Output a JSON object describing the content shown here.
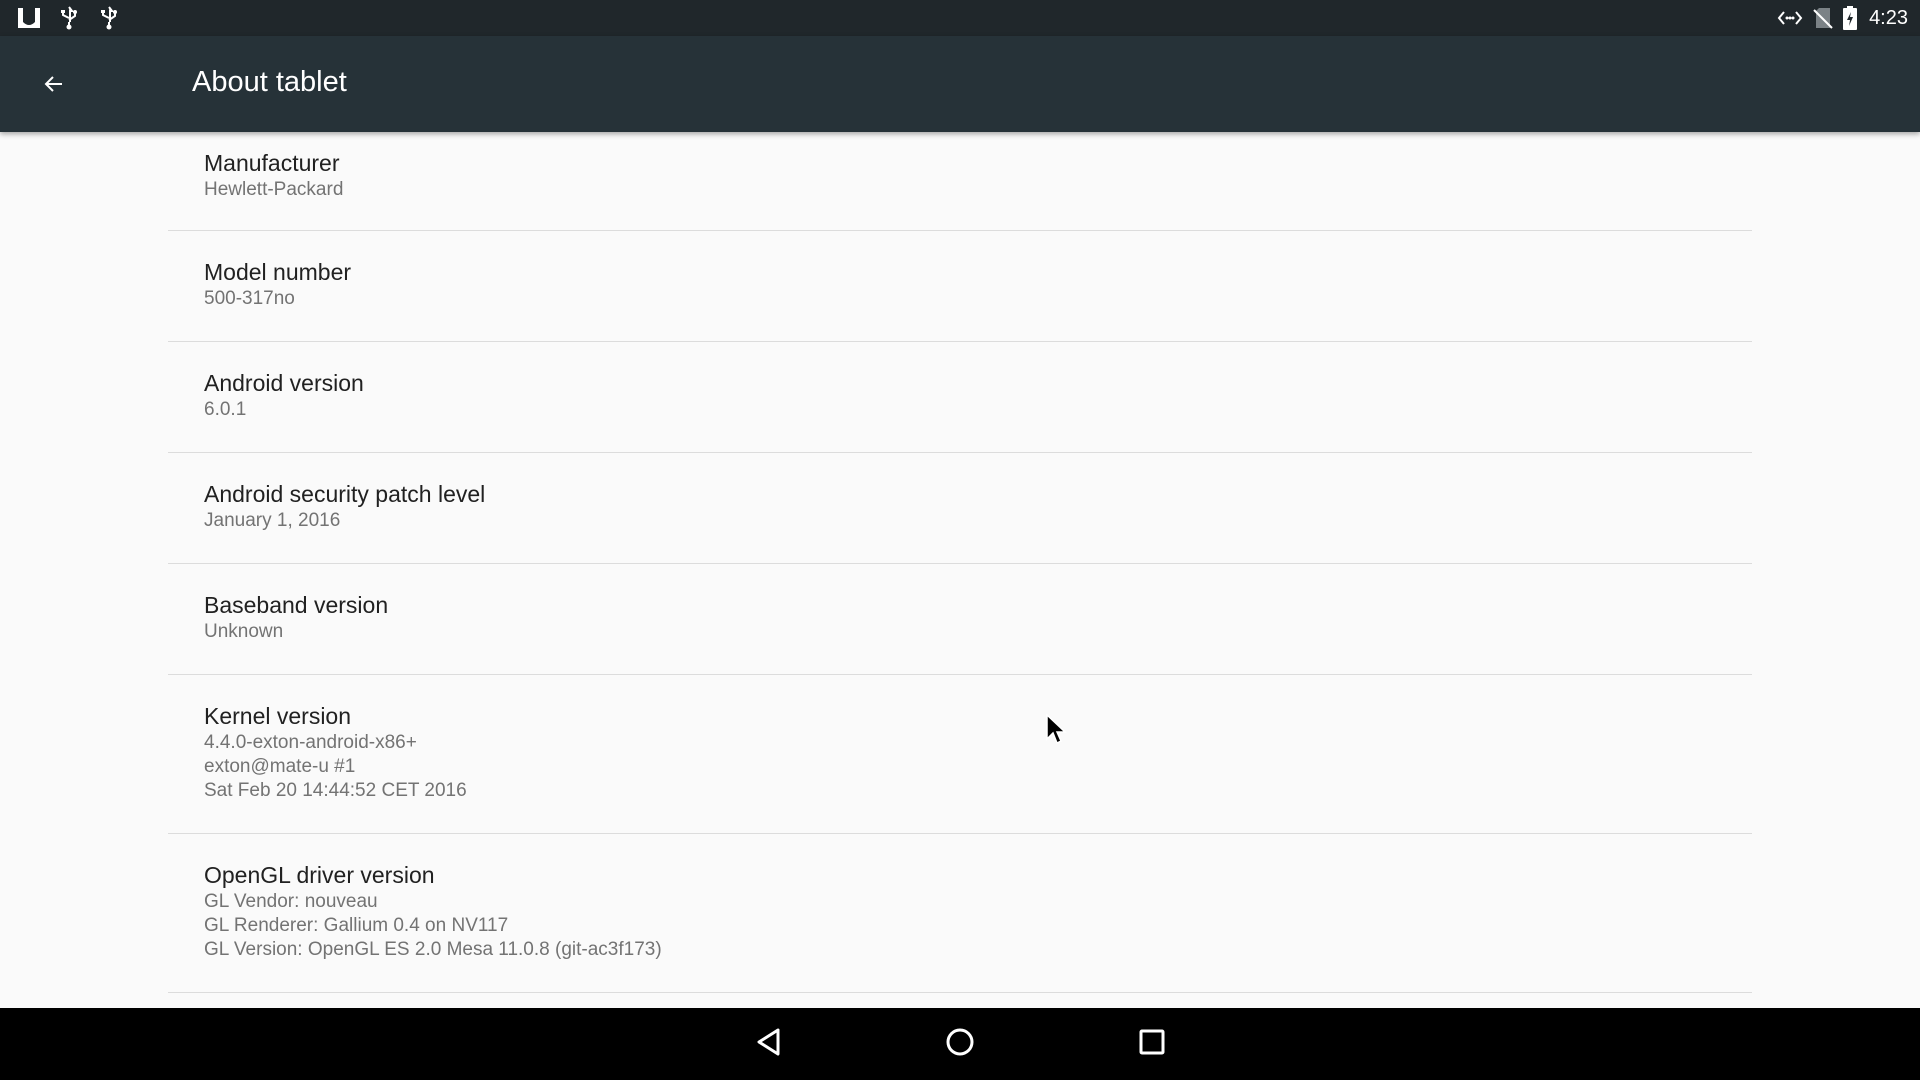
{
  "status_bar": {
    "left_icons": [
      "app-notification-icon",
      "usb-icon",
      "usb-icon"
    ],
    "right_icons": [
      "data-transfer-icon",
      "no-sim-icon",
      "battery-charging-icon"
    ],
    "time": "4:23"
  },
  "app_bar": {
    "back_icon": "arrow-back-icon",
    "title": "About tablet",
    "background": "#263238"
  },
  "items": [
    {
      "title": "Manufacturer",
      "values": [
        "Hewlett-Packard"
      ]
    },
    {
      "title": "Model number",
      "values": [
        "500-317no"
      ]
    },
    {
      "title": "Android version",
      "values": [
        "6.0.1"
      ]
    },
    {
      "title": "Android security patch level",
      "values": [
        "January 1, 2016"
      ]
    },
    {
      "title": "Baseband version",
      "values": [
        "Unknown"
      ]
    },
    {
      "title": "Kernel version",
      "values": [
        "4.4.0-exton-android-x86+",
        "exton@mate-u #1",
        "Sat Feb 20 14:44:52 CET 2016"
      ]
    },
    {
      "title": "OpenGL driver version",
      "values": [
        "GL Vendor: nouveau",
        "GL Renderer: Gallium 0.4 on NV117",
        "GL Version: OpenGL ES 2.0 Mesa 11.0.8 (git-ac3f173)"
      ]
    }
  ],
  "nav_bar": {
    "buttons": [
      "back-triangle-icon",
      "home-circle-icon",
      "recents-square-icon"
    ]
  }
}
